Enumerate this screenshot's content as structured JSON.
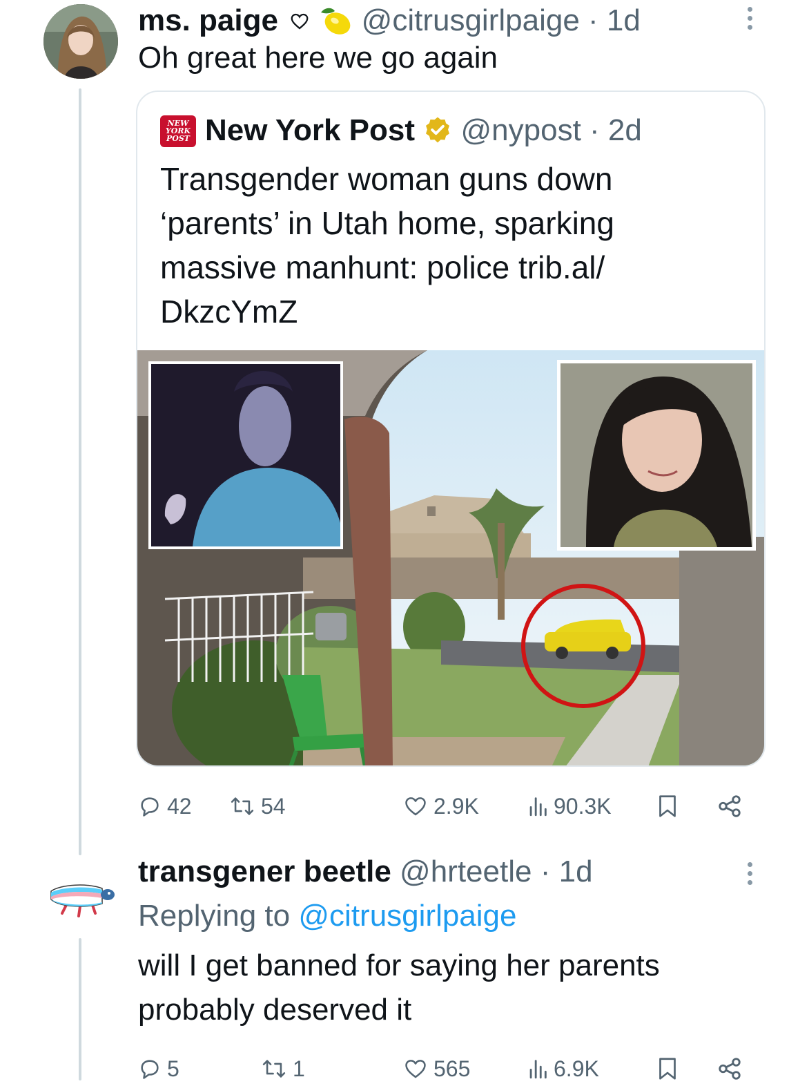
{
  "tweet1": {
    "name": "ms. paige",
    "badges": [
      "heart-outline-icon",
      "lemon-icon"
    ],
    "handle": "@citrusgirlpaige",
    "time": "· 1d",
    "text": "Oh great here we go again",
    "quote": {
      "name": "New York Post",
      "logo_text": "NEW YORK POST",
      "handle": "@nypost",
      "time": "· 2d",
      "text": "Transgender woman guns down ‘parents’ in Utah home, sparking massive manhunt: police trib.al/ DkzcYmZ"
    },
    "metrics": {
      "replies": "42",
      "retweets": "54",
      "likes": "2.9K",
      "views": "90.3K"
    }
  },
  "tweet2": {
    "name": "transgener beetle",
    "handle": "@hrteetle",
    "time": "· 1d",
    "replying_prefix": "Replying to",
    "replying_to": "@citrusgirlpaige",
    "text": "will I get banned for saying her parents probably deserved it",
    "metrics": {
      "replies": "5",
      "retweets": "1",
      "likes": "565",
      "views": "6.9K"
    }
  },
  "colors": {
    "text": "#0f1419",
    "secondary": "#536471",
    "link": "#1d9bf0",
    "verified_gold": "#e2b719",
    "nypost_red": "#c8102e"
  }
}
